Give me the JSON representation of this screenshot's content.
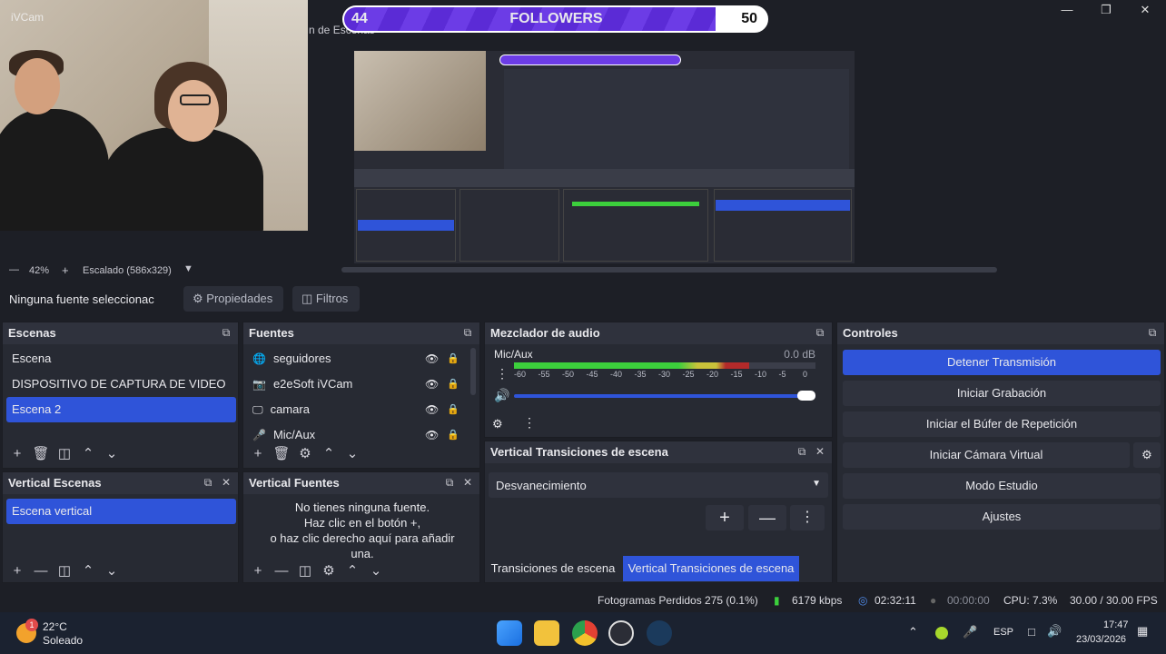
{
  "overlay": {
    "webcam_label": "iVCam",
    "followers": {
      "current": "44",
      "label": "FOLLOWERS",
      "goal": "50",
      "progress": 0.88
    }
  },
  "obs": {
    "menu_peek": "n de Escenas",
    "zoom": {
      "value": "42%",
      "scale_label": "Escalado (586x329)"
    },
    "source_bar": {
      "selected_source": "Ninguna fuente seleccionac",
      "properties_label": "Propiedades",
      "filters_label": "Filtros"
    },
    "scenes": {
      "title": "Escenas",
      "items": [
        {
          "label": "Escena",
          "selected": false
        },
        {
          "label": "DISPOSITIVO DE CAPTURA DE VIDEO",
          "selected": false
        },
        {
          "label": "Escena 2",
          "selected": true
        }
      ]
    },
    "sources": {
      "title": "Fuentes",
      "items": [
        {
          "label": "seguidores",
          "icon": "globe-icon"
        },
        {
          "label": "e2eSoft iVCam",
          "icon": "camera-icon"
        },
        {
          "label": "camara",
          "icon": "monitor-icon"
        },
        {
          "label": "Mic/Aux",
          "icon": "mic-icon"
        }
      ]
    },
    "mixer": {
      "title": "Mezclador de audio",
      "channel": "Mic/Aux",
      "db": "0.0 dB",
      "ticks": [
        "-60",
        "-55",
        "-50",
        "-45",
        "-40",
        "-35",
        "-30",
        "-25",
        "-20",
        "-15",
        "-10",
        "-5",
        "0"
      ],
      "level": 0.78,
      "volume": 1.0
    },
    "controls": {
      "title": "Controles",
      "buttons": [
        "Detener Transmisión",
        "Iniciar Grabación",
        "Iniciar el Búfer de Repetición",
        "Iniciar Cámara Virtual",
        "Modo Estudio",
        "Ajustes"
      ]
    },
    "vertical_scenes": {
      "title": "Vertical Escenas",
      "items": [
        {
          "label": "Escena vertical",
          "selected": true
        }
      ]
    },
    "vertical_sources": {
      "title": "Vertical Fuentes",
      "empty_line1": "No tienes ninguna fuente.",
      "empty_line2": "Haz clic en el botón +,",
      "empty_line3": "o haz clic derecho aquí para añadir",
      "empty_line4": "una."
    },
    "vertical_transitions": {
      "title": "Vertical Transiciones de escena",
      "selected": "Desvanecimiento",
      "tab1": "Transiciones de escena",
      "tab2": "Vertical Transiciones de escena"
    },
    "status": {
      "dropped": "Fotogramas Perdidos 275 (0.1%)",
      "bitrate": "6179 kbps",
      "stream_time": "02:32:11",
      "rec_time": "00:00:00",
      "cpu": "CPU: 7.3%",
      "fps": "30.00 / 30.00 FPS"
    }
  },
  "taskbar": {
    "weather_temp": "22°C",
    "weather_desc": "Soleado",
    "weather_badge": "1",
    "lang": "ESP",
    "time": "17:47",
    "date": "23/03/2026"
  },
  "colors": {
    "accent": "#2f54d9",
    "panel": "#272a33",
    "bg": "#1d1f26",
    "followers_purple": "#5b2bd6"
  }
}
